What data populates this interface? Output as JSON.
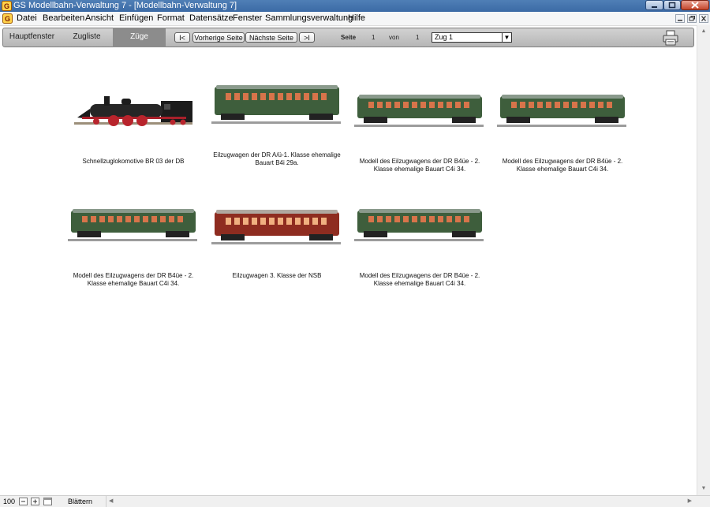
{
  "window": {
    "title": "GS Modellbahn-Verwaltung 7 - [Modellbahn-Verwaltung 7]"
  },
  "menu": {
    "items": [
      "Datei",
      "Bearbeiten",
      "Ansicht",
      "Einfügen",
      "Format",
      "Datensätze",
      "Fenster",
      "Sammlungsverwaltung",
      "Hilfe"
    ]
  },
  "navbar": {
    "tabs": [
      {
        "label": "Hauptfenster",
        "active": false
      },
      {
        "label": "Zugliste",
        "active": false
      },
      {
        "label": "Züge",
        "active": true
      }
    ],
    "first_label": "I<",
    "prev_label": "Vorherige Seite",
    "next_label": "Nächste Seite",
    "last_label": ">I",
    "page_label": "Seite",
    "page_current": "1",
    "page_of_label": "von",
    "page_total": "1",
    "train_select": "Zug 1"
  },
  "colors": {
    "navbar_bg": "#c4c4c4",
    "tab_active_bg": "#8c8c8c",
    "titlebar": "#4a7ab4",
    "wagon_green": "#3e5e3c",
    "wagon_red": "#8e2c20",
    "loco_black": "#1c1c1c"
  },
  "vehicles": [
    {
      "caption": "Schnellzuglokomotive BR 03 der DB",
      "kind": "locomotive",
      "color": "#1c1c1c"
    },
    {
      "caption": "Eilzugwagen der DR A/ü-1. Klasse ehemalige Bauart B4i 29a.",
      "kind": "wagon",
      "color": "#3e5e3c"
    },
    {
      "caption": "Modell des Eilzugwagens der DR B4üe - 2. Klasse ehemalige Bauart C4i 34.",
      "kind": "wagon",
      "color": "#3e5e3c"
    },
    {
      "caption": "Modell des Eilzugwagens der DR B4üe - 2. Klasse ehemalige Bauart C4i 34.",
      "kind": "wagon",
      "color": "#3e5e3c"
    },
    {
      "caption": "Modell des Eilzugwagens der DR B4üe - 2. Klasse ehemalige Bauart C4i 34.",
      "kind": "wagon",
      "color": "#3e5e3c"
    },
    {
      "caption": "Eilzugwagen 3. Klasse der NSB",
      "kind": "wagon",
      "color": "#8e2c20"
    },
    {
      "caption": "Modell des Eilzugwagens der DR B4üe - 2. Klasse ehemalige Bauart C4i 34.",
      "kind": "wagon",
      "color": "#3e5e3c"
    }
  ],
  "statusbar": {
    "zoom": "100",
    "mode": "Blättern"
  },
  "icons": [
    "app-icon",
    "document-icon",
    "minimize-icon",
    "maximize-icon",
    "close-icon",
    "printer-icon",
    "scroll-up-icon",
    "scroll-down-icon",
    "zoom-out-icon",
    "zoom-in-icon",
    "layout-icon"
  ]
}
